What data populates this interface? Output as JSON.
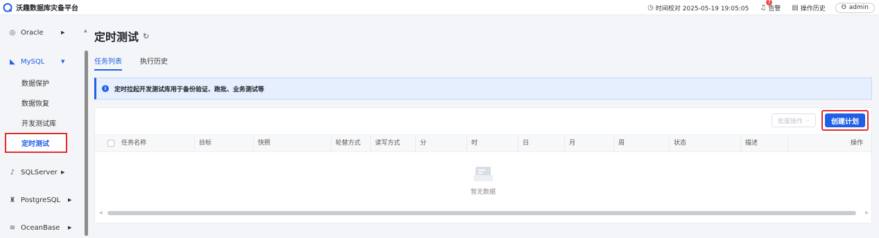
{
  "header": {
    "title": "沃趣数据库灾备平台",
    "time_label": "时间校对 2025-05-19 19:05:05",
    "alert_label": "告警",
    "alert_count": "7",
    "history_label": "操作历史",
    "user": "admin"
  },
  "sidebar": {
    "groups": [
      {
        "label": "Oracle",
        "icon": "database-icon"
      },
      {
        "label": "MySQL",
        "icon": "dolphin-icon"
      },
      {
        "label": "SQLServer",
        "icon": "sqlserver-icon"
      },
      {
        "label": "PostgreSQL",
        "icon": "elephant-icon"
      },
      {
        "label": "OceanBase",
        "icon": "oceanbase-icon"
      }
    ],
    "mysql_items": [
      "数据保护",
      "数据恢复",
      "开发测试库",
      "定时测试"
    ]
  },
  "page": {
    "title": "定时测试",
    "tabs": [
      "任务列表",
      "执行历史"
    ],
    "notice": "定时拉起开发测试库用于备份验证、跑批、业务测试等",
    "batch_label": "批量操作",
    "create_label": "创建计划",
    "columns": [
      "任务名称",
      "目标",
      "快照",
      "轮替方式",
      "读写方式",
      "分",
      "时",
      "日",
      "月",
      "周",
      "状态",
      "描述",
      "操作"
    ],
    "empty_text": "暂无数据"
  },
  "colors": {
    "accent": "#1f60e6",
    "highlight": "#e52a2a",
    "badge": "#f24e4e"
  }
}
